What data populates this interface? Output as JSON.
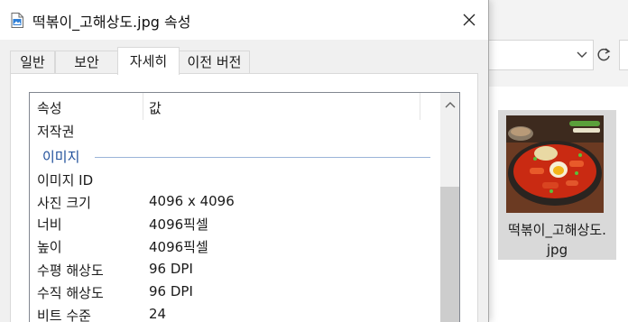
{
  "dialog": {
    "title": "떡볶이_고해상도.jpg 속성",
    "tabs": [
      {
        "label": "일반"
      },
      {
        "label": "보안"
      },
      {
        "label": "자세히"
      },
      {
        "label": "이전 버전"
      }
    ],
    "active_tab": "자세히",
    "columns": {
      "property": "속성",
      "value": "값"
    },
    "rows_top": [
      {
        "key": "저작권",
        "value": ""
      }
    ],
    "group_image": "이미지",
    "rows": [
      {
        "key": "이미지 ID",
        "value": ""
      },
      {
        "key": "사진 크기",
        "value": "4096 x 4096"
      },
      {
        "key": "너비",
        "value": "4096픽셀"
      },
      {
        "key": "높이",
        "value": "4096픽셀"
      },
      {
        "key": "수평 해상도",
        "value": "96 DPI"
      },
      {
        "key": "수직 해상도",
        "value": "96 DPI"
      },
      {
        "key": "비트 수준",
        "value": "24"
      }
    ]
  },
  "explorer": {
    "file_name_line1": "떡볶이_고해상도.",
    "file_name_line2": "jpg"
  },
  "colors": {
    "group_label": "#1e4e9a",
    "selection": "#d9d9d9"
  }
}
